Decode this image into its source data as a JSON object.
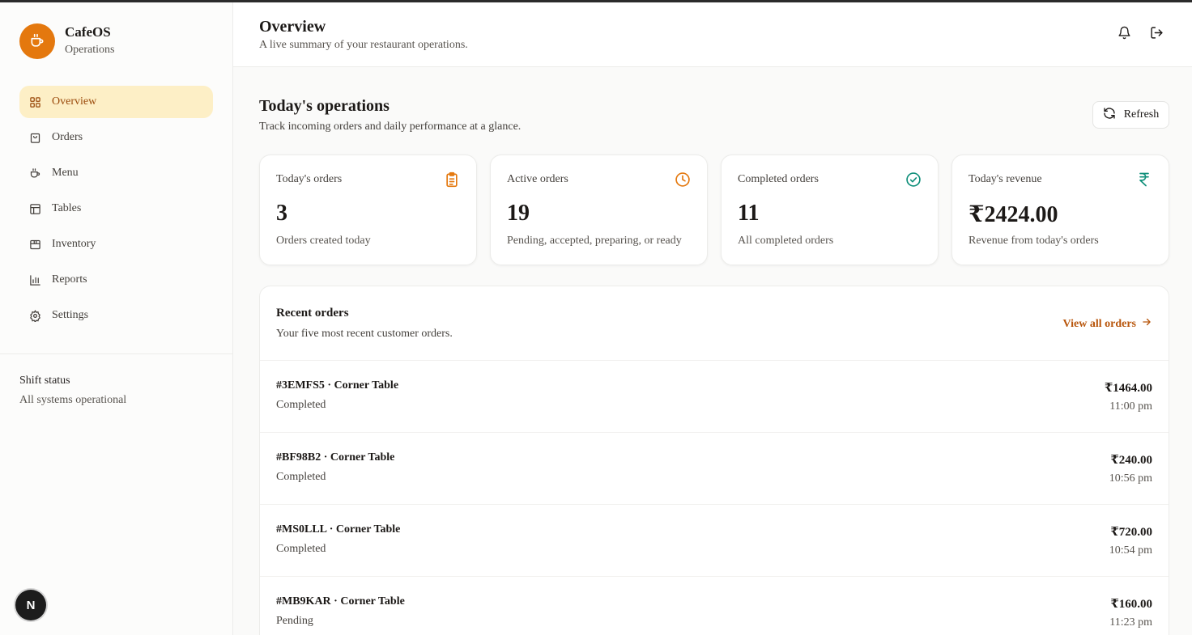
{
  "brand": {
    "name": "CafeOS",
    "subtitle": "Operations",
    "logo_icon": "coffee-cup-icon",
    "color": "#e4780e"
  },
  "sidebar": {
    "items": [
      {
        "label": "Overview",
        "icon": "grid-icon",
        "active": true
      },
      {
        "label": "Orders",
        "icon": "shopping-bag-icon"
      },
      {
        "label": "Menu",
        "icon": "coffee-icon"
      },
      {
        "label": "Tables",
        "icon": "table-icon"
      },
      {
        "label": "Inventory",
        "icon": "box-icon"
      },
      {
        "label": "Reports",
        "icon": "bar-chart-icon"
      },
      {
        "label": "Settings",
        "icon": "gear-icon"
      }
    ],
    "shift": {
      "title": "Shift status",
      "status": "All systems operational"
    },
    "badge": "N"
  },
  "header": {
    "title": "Overview",
    "subtitle": "A live summary of your restaurant operations.",
    "actions": [
      "bell-icon",
      "logout-icon"
    ]
  },
  "main": {
    "title": "Today's operations",
    "subtitle": "Track incoming orders and daily performance at a glance.",
    "refresh_label": "Refresh",
    "stats": [
      {
        "label": "Today's orders",
        "value": "3",
        "desc": "Orders created today",
        "icon": "clipboard-icon",
        "color": "#e4780e"
      },
      {
        "label": "Active orders",
        "value": "19",
        "desc": "Pending, accepted, preparing, or ready",
        "icon": "clock-icon",
        "color": "#e4780e"
      },
      {
        "label": "Completed orders",
        "value": "11",
        "desc": "All completed orders",
        "icon": "check-circle-icon",
        "color": "#0f8f7a"
      },
      {
        "label": "Today's revenue",
        "value": "₹2424.00",
        "desc": "Revenue from today's orders",
        "icon": "rupee-icon",
        "color": "#0f8f7a"
      }
    ],
    "recent": {
      "title": "Recent orders",
      "subtitle": "Your five most recent customer orders.",
      "view_all": "View all orders",
      "orders": [
        {
          "id": "#3EMFS5 · Corner Table",
          "status": "Completed",
          "amount": "₹1464.00",
          "time": "11:00 pm"
        },
        {
          "id": "#BF98B2 · Corner Table",
          "status": "Completed",
          "amount": "₹240.00",
          "time": "10:56 pm"
        },
        {
          "id": "#MS0LLL · Corner Table",
          "status": "Completed",
          "amount": "₹720.00",
          "time": "10:54 pm"
        },
        {
          "id": "#MB9KAR · Corner Table",
          "status": "Pending",
          "amount": "₹160.00",
          "time": "11:23 pm"
        }
      ]
    }
  },
  "colors": {
    "accent": "#e4780e",
    "active_bg": "#fdefc6",
    "link": "#b8560c",
    "success": "#0f8f7a"
  }
}
